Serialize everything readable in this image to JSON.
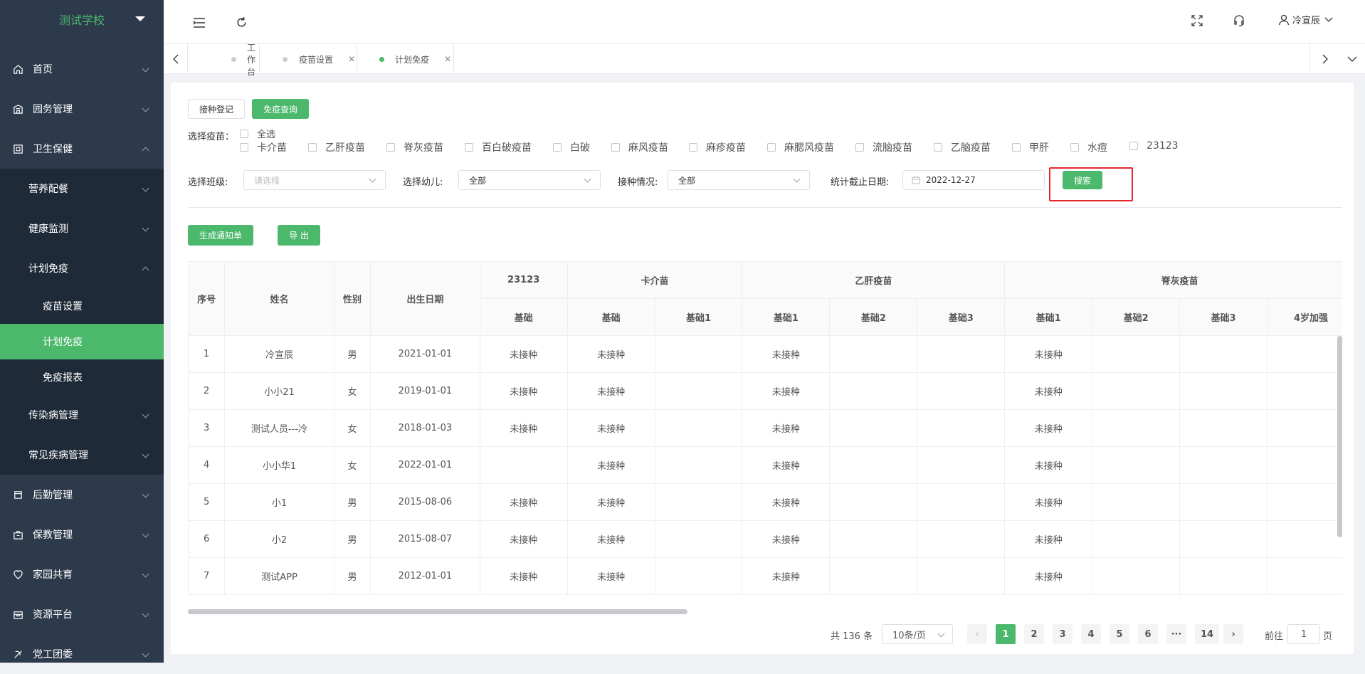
{
  "app": {
    "school_name": "测试学校",
    "user_name": "冷宣辰"
  },
  "sidebar": {
    "items": [
      {
        "label": "首页",
        "icon": "home-icon"
      },
      {
        "label": "园务管理",
        "icon": "building-icon"
      },
      {
        "label": "卫生保健",
        "icon": "health-icon"
      },
      {
        "label": "营养配餐"
      },
      {
        "label": "健康监测"
      },
      {
        "label": "计划免疫"
      },
      {
        "label": "疫苗设置"
      },
      {
        "label": "计划免疫"
      },
      {
        "label": "免疫报表"
      },
      {
        "label": "传染病管理"
      },
      {
        "label": "常见疾病管理"
      },
      {
        "label": "后勤管理",
        "icon": "logistics-icon"
      },
      {
        "label": "保教管理",
        "icon": "education-icon"
      },
      {
        "label": "家园共育",
        "icon": "family-icon"
      },
      {
        "label": "资源平台",
        "icon": "resource-icon"
      },
      {
        "label": "党工团委",
        "icon": "party-icon"
      }
    ]
  },
  "tabs": [
    {
      "label": "工作台"
    },
    {
      "label": "疫苗设置"
    },
    {
      "label": "计划免疫"
    }
  ],
  "toolbar": {
    "register_label": "接种登记",
    "query_label": "免疫查询"
  },
  "filters": {
    "vaccine_label": "选择疫苗：",
    "select_all": "全选",
    "vaccines": [
      "卡介苗",
      "乙肝疫苗",
      "脊灰疫苗",
      "百白破疫苗",
      "白破",
      "麻风疫苗",
      "麻疹疫苗",
      "麻腮风疫苗",
      "流脑疫苗",
      "乙脑疫苗",
      "甲肝",
      "水痘",
      "23123"
    ],
    "class_label": "选择班级:",
    "class_placeholder": "请选择",
    "child_label": "选择幼儿:",
    "child_value": "全部",
    "status_label": "接种情况:",
    "status_value": "全部",
    "date_label": "统计截止日期:",
    "date_value": "2022-12-27",
    "search_label": "搜索"
  },
  "actions": {
    "notice_label": "生成通知单",
    "export_label": "导 出"
  },
  "table": {
    "headers": {
      "index": "序号",
      "name": "姓名",
      "gender": "性别",
      "birth": "出生日期"
    },
    "groups": [
      "23123",
      "卡介苗",
      "乙肝疫苗",
      "脊灰疫苗"
    ],
    "subheaders": [
      "基础",
      "基础",
      "基础1",
      "基础1",
      "基础2",
      "基础3",
      "基础1",
      "基础2",
      "基础3",
      "4岁加强"
    ],
    "rows": [
      {
        "idx": "1",
        "name": "冷宣辰",
        "gender": "男",
        "birth": "2021-01-01",
        "c": [
          "未接种",
          "未接种",
          "",
          "未接种",
          "",
          "",
          "未接种",
          "",
          "",
          ""
        ]
      },
      {
        "idx": "2",
        "name": "小小21",
        "gender": "女",
        "birth": "2019-01-01",
        "c": [
          "未接种",
          "未接种",
          "",
          "未接种",
          "",
          "",
          "未接种",
          "",
          "",
          ""
        ]
      },
      {
        "idx": "3",
        "name": "测试人员---冷",
        "gender": "女",
        "birth": "2018-01-03",
        "c": [
          "未接种",
          "未接种",
          "",
          "未接种",
          "",
          "",
          "未接种",
          "",
          "",
          ""
        ]
      },
      {
        "idx": "4",
        "name": "小小华1",
        "gender": "女",
        "birth": "2022-01-01",
        "c": [
          "",
          "未接种",
          "",
          "未接种",
          "",
          "",
          "未接种",
          "",
          "",
          ""
        ]
      },
      {
        "idx": "5",
        "name": "小1",
        "gender": "男",
        "birth": "2015-08-06",
        "c": [
          "未接种",
          "未接种",
          "",
          "未接种",
          "",
          "",
          "未接种",
          "",
          "",
          ""
        ]
      },
      {
        "idx": "6",
        "name": "小2",
        "gender": "男",
        "birth": "2015-08-07",
        "c": [
          "未接种",
          "未接种",
          "",
          "未接种",
          "",
          "",
          "未接种",
          "",
          "",
          ""
        ]
      },
      {
        "idx": "7",
        "name": "测试APP",
        "gender": "男",
        "birth": "2012-01-01",
        "c": [
          "未接种",
          "未接种",
          "",
          "未接种",
          "",
          "",
          "未接种",
          "",
          "",
          ""
        ]
      }
    ]
  },
  "pagination": {
    "total": "共 136 条",
    "page_size": "10条/页",
    "pages": [
      "1",
      "2",
      "3",
      "4",
      "5",
      "6",
      "···",
      "14"
    ],
    "goto_label": "前往",
    "goto_value": "1",
    "page_suffix": "页"
  }
}
